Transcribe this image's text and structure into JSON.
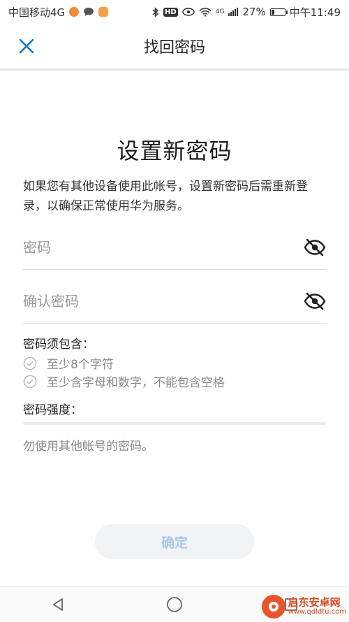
{
  "status_bar": {
    "carrier": "中国移动4G",
    "network_label": "4G",
    "battery_text": "27%",
    "battery_level": 0.27,
    "time": "中午11:49"
  },
  "appbar": {
    "title": "找回密码"
  },
  "main": {
    "heading": "设置新密码",
    "description": "如果您有其他设备使用此帐号，设置新密码后需重新登录，以确保正常使用华为服务。"
  },
  "form": {
    "password_placeholder": "密码",
    "confirm_placeholder": "确认密码"
  },
  "requirements": {
    "title": "密码须包含：",
    "items": [
      "至少8个字符",
      "至少含字母和数字，不能包含空格"
    ]
  },
  "strength": {
    "label": "密码强度：",
    "level": 0
  },
  "tip": "勿使用其他帐号的密码。",
  "confirm_button": "确定",
  "watermark": {
    "name": "启东安卓网",
    "url": "www.qdldtu.com"
  },
  "colors": {
    "accent": "#1a73c9",
    "button_bg": "#f2f3f5",
    "button_text": "#a8c8ea",
    "hint_text": "#8a8a8a"
  },
  "icons": {
    "close": "close-icon",
    "eye_hidden": "eye-off-icon",
    "check": "check-circle-icon",
    "nav_back": "triangle-back-icon",
    "nav_home": "circle-home-icon",
    "nav_recent": "square-recent-icon"
  }
}
